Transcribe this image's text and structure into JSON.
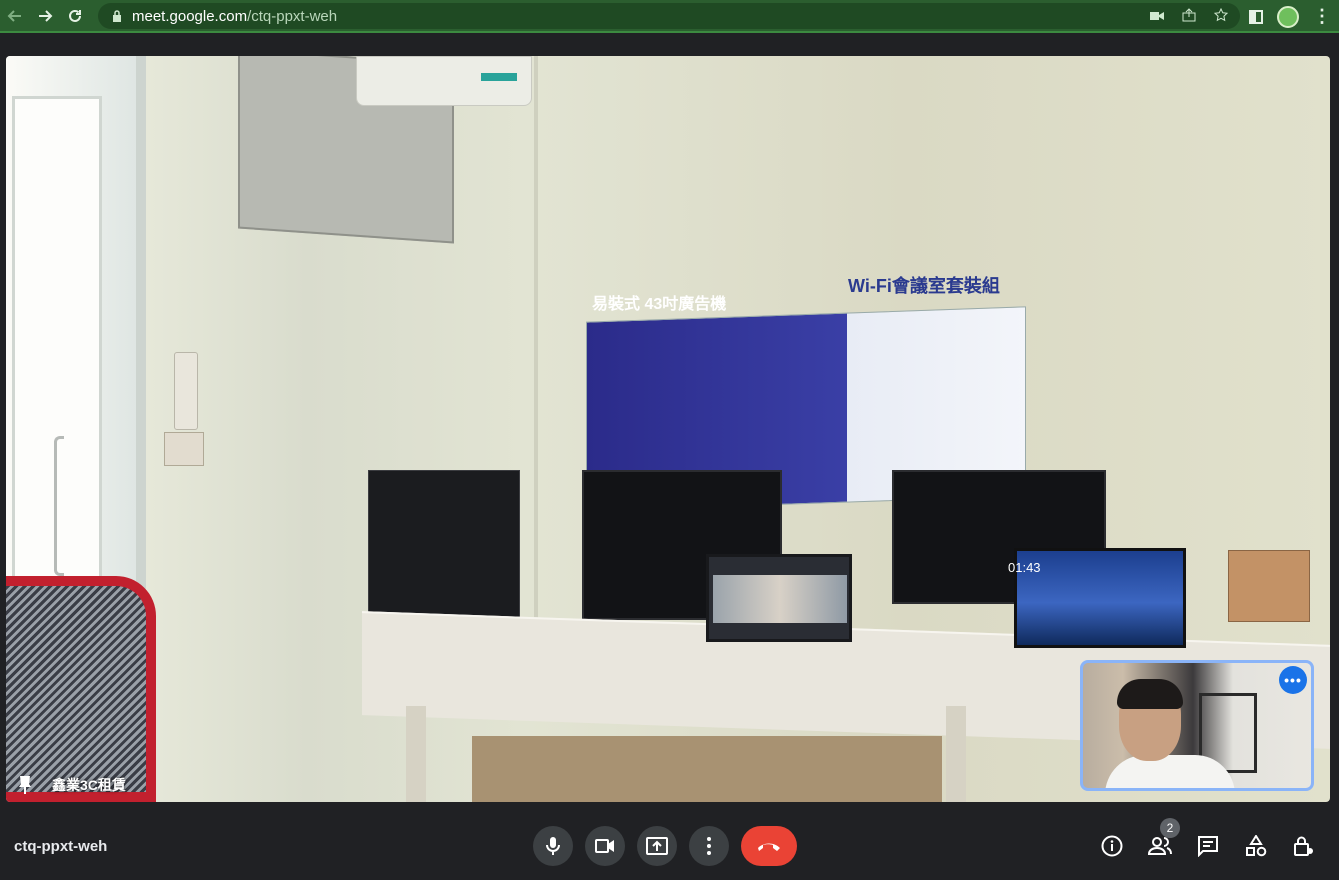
{
  "browser": {
    "url_domain": "meet.google.com",
    "url_path": "/ctq-ppxt-weh",
    "icons": [
      "back-arrow-icon",
      "forward-arrow-icon",
      "reload-icon",
      "lock-icon",
      "camera-indicator-icon",
      "share-icon",
      "bookmark-star-icon",
      "side-panel-icon",
      "profile-avatar",
      "kebab-menu-icon"
    ]
  },
  "video": {
    "pinned_participant": "鑫業3C租賃",
    "scene_text": {
      "poster_left": "易裝式 43吋廣告機",
      "poster_right": "Wi-Fi會議室套裝組",
      "laptop_time": "01:43"
    },
    "self_view_menu": "•••"
  },
  "meeting": {
    "code": "ctq-ppxt-weh",
    "participants_count": "2",
    "controls": [
      "microphone",
      "camera",
      "present-screen",
      "more-options",
      "leave-call"
    ],
    "right_controls": [
      "meeting-details",
      "people",
      "chat",
      "activities",
      "host-controls"
    ]
  },
  "colors": {
    "browser_theme": "#2b5e2f",
    "meet_background": "#202124",
    "control_button": "#3c4043",
    "leave_button": "#ea4335",
    "self_view_border": "#8ab4f8",
    "accent_blue": "#1a73e8"
  }
}
